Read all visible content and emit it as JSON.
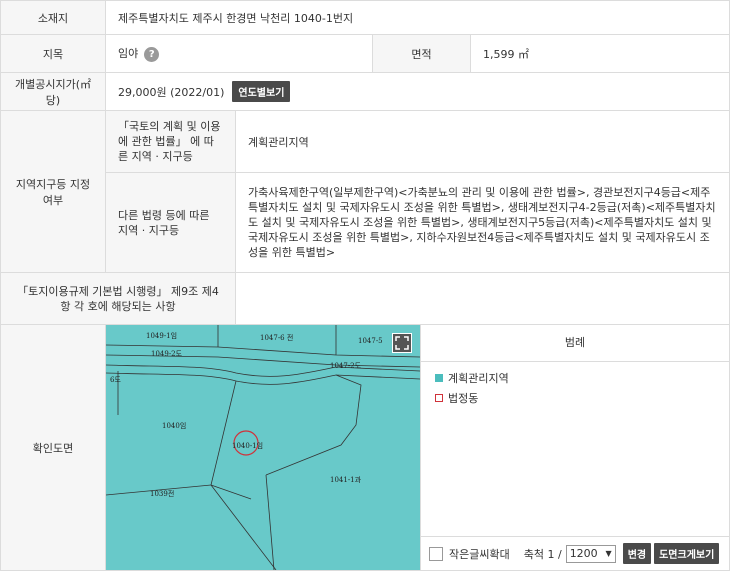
{
  "rows": {
    "location_label": "소재지",
    "location_value": "제주특별자치도 제주시 한경면 낙천리 1040-1번지",
    "category_label": "지목",
    "category_value": "임야",
    "area_label": "면적",
    "area_value": "1,599 ㎡",
    "price_label": "개별공시지가(㎡당)",
    "price_value": "29,000원 (2022/01)",
    "price_button": "연도별보기",
    "zone_label": "지역지구등 지정여부",
    "zone_sub1": "「국토의 계획 및 이용에 관한 법률」 에 따른 지역 · 지구등",
    "zone_val1": "계획관리지역",
    "zone_sub2": "다른 법령 등에 따른 지역 · 지구등",
    "zone_val2": "가축사육제한구역(일부제한구역)<가축분뇨의 관리 및 이용에 관한 법률>, 경관보전지구4등급<제주특별자치도 설치 및 국제자유도시 조성을 위한 특별법>, 생태계보전지구4-2등급(저촉)<제주특별자치도 설치 및 국제자유도시 조성을 위한 특별법>, 생태계보전지구5등급(저촉)<제주특별자치도 설치 및 국제자유도시 조성을 위한 특별법>, 지하수자원보전4등급<제주특별자치도 설치 및 국제자유도시 조성을 위한 특별법>",
    "regulation_label": "「토지이용규제 기본법 시행령」 제9조 제4항 각 호에 해당되는 사항",
    "map_label": "확인도면"
  },
  "map": {
    "parcels": [
      "1049-1임",
      "1049-2도",
      "1047-6 전",
      "1047-5",
      "1047-2도",
      "1040임",
      "1040-1임",
      "1041-1과",
      "1039전",
      "6도"
    ],
    "fullscreen_icon": "expand-icon"
  },
  "legend": {
    "title": "범례",
    "items": [
      "계획관리지역",
      "법정동"
    ],
    "colors": {
      "zone": "#4bbdbd",
      "dong": "#d0323a"
    }
  },
  "controls": {
    "small_text_label": "작은글씨확대",
    "scale_label": "축척 1 /",
    "scale_value": "1200",
    "change_button": "변경",
    "enlarge_button": "도면크게보기"
  }
}
